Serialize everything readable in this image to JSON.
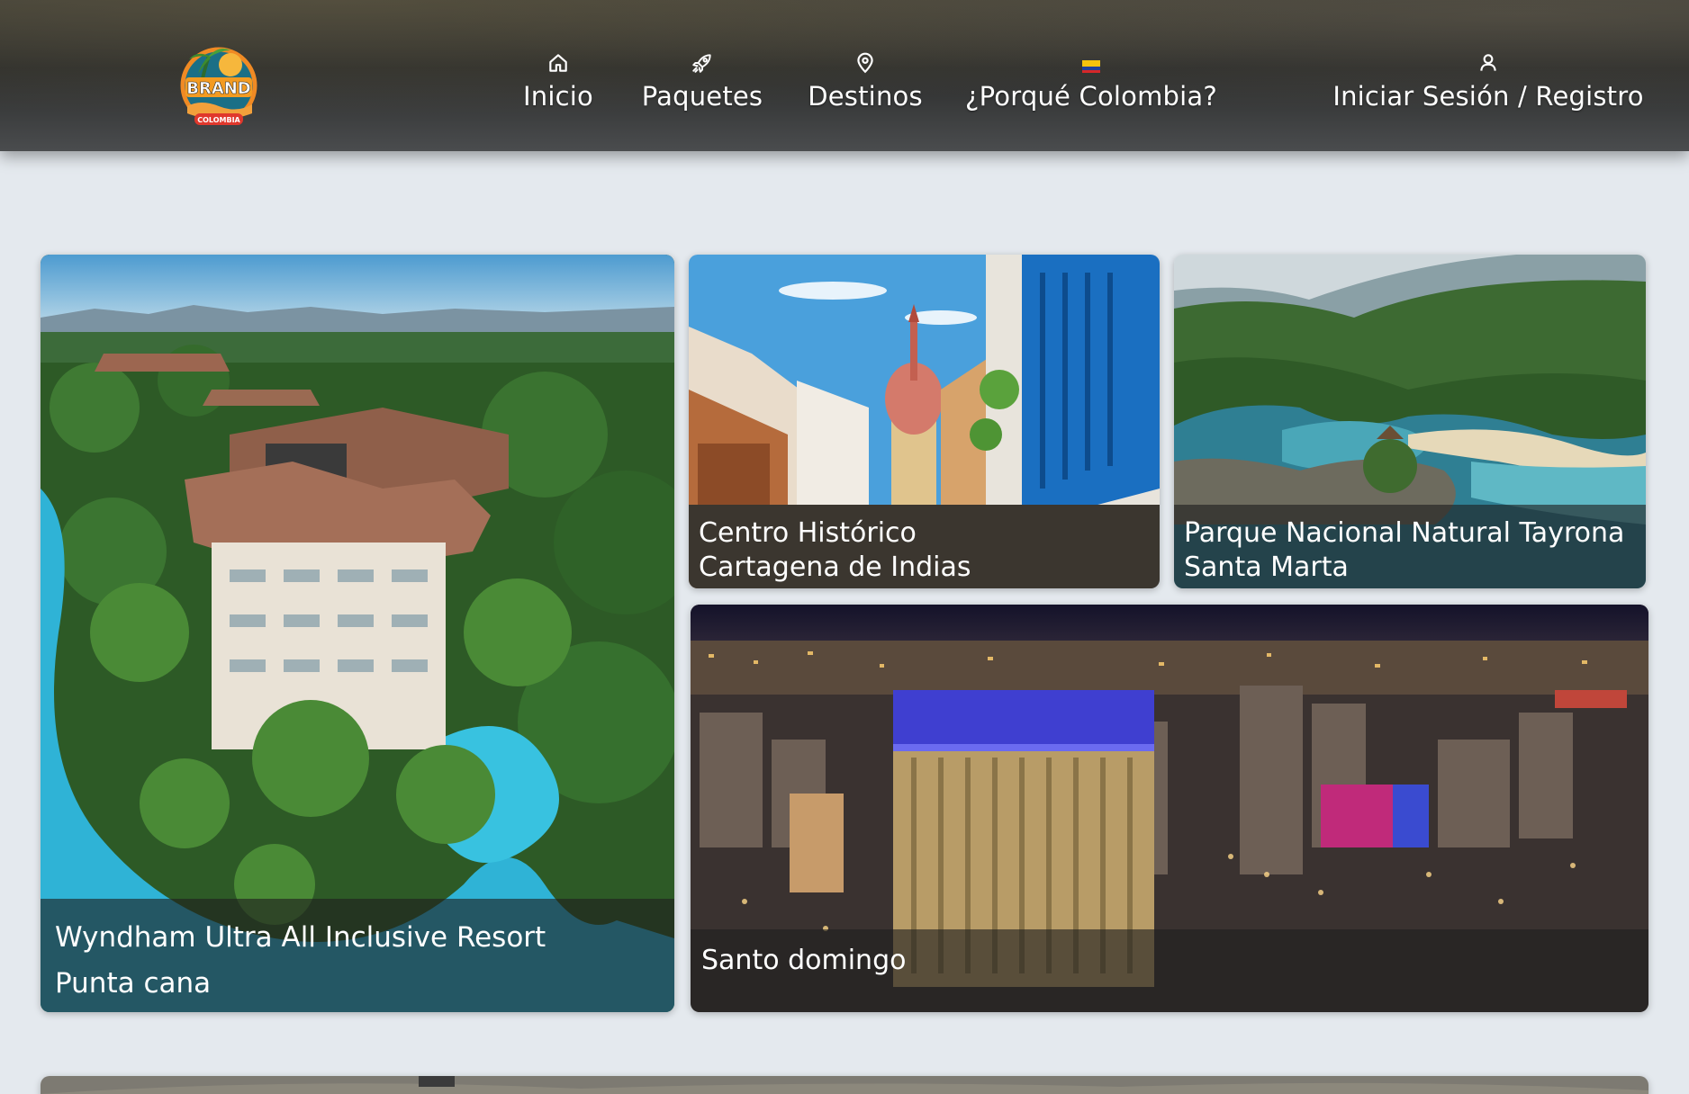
{
  "header": {
    "logo": {
      "main_text": "BRAND",
      "sub_text": "COLOMBIA"
    },
    "nav": [
      {
        "label": "Inicio",
        "icon": "home-icon"
      },
      {
        "label": "Paquetes",
        "icon": "rocket-icon"
      },
      {
        "label": "Destinos",
        "icon": "location-pin-icon"
      },
      {
        "label": "¿Porqué Colombia?",
        "icon": "colombia-flag-icon"
      },
      {
        "label": "Iniciar Sesión / Registro",
        "icon": "user-icon"
      }
    ]
  },
  "destinations": [
    {
      "title": "Wyndham Ultra All Inclusive Resort",
      "subtitle": "Punta cana"
    },
    {
      "title": "Centro Histórico",
      "subtitle": "Cartagena de Indias"
    },
    {
      "title": "Parque Nacional Natural Tayrona",
      "subtitle": "Santa Marta"
    },
    {
      "title": "Santo domingo"
    }
  ],
  "colors": {
    "page_background": "#e4e9ee",
    "caption_overlay": "rgba(30,30,30,0.62)",
    "header_background": "#2b2c2b",
    "flag_yellow": "#f4c20d",
    "flag_blue": "#1f3f99",
    "flag_red": "#d62828"
  }
}
